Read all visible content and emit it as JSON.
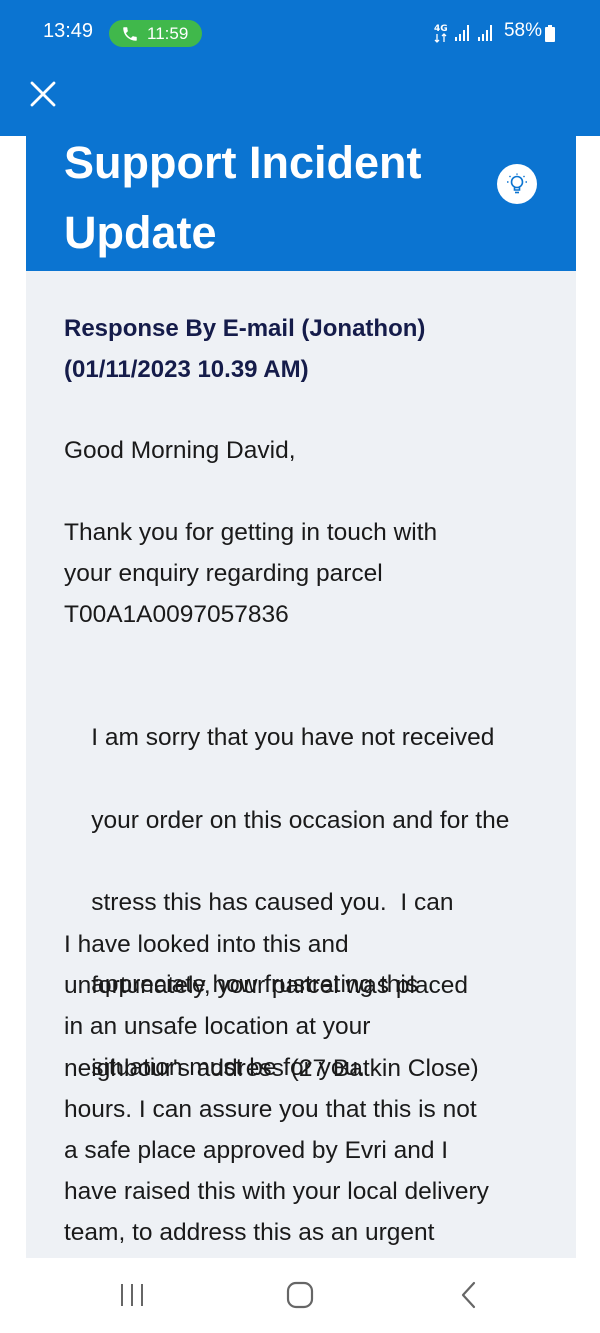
{
  "status_bar": {
    "time": "13:49",
    "call_duration": "11:59",
    "network": "4G",
    "battery": "58%"
  },
  "header": {
    "title": "Support Incident Update",
    "close_icon": "close-icon",
    "tip_icon": "lightbulb-icon"
  },
  "message": {
    "heading_line1": "Response By E-mail (Jonathon)",
    "heading_line2": "(01/11/2023 10.39 AM)",
    "greeting": "Good Morning David,",
    "para1": [
      "Thank you for getting in touch with",
      "your enquiry regarding parcel",
      "T00A1A0097057836"
    ],
    "para2": [
      "I am sorry that you have not received",
      "your order on this occasion and for the",
      "stress this has caused you.  I can",
      "appreciate how frustrating this",
      "situation must be for you."
    ],
    "para3": [
      "I have looked into this and",
      "unfortunately, your parcel was placed",
      "in an unsafe location at your",
      "neighbour's address (27 Batkin Close)",
      "hours. I can assure you that this is not",
      "a safe place approved by Evri and I",
      "have raised this with your local delivery",
      "team, to address this as an urgent"
    ]
  },
  "nav": {
    "recents_icon": "recents-icon",
    "home_icon": "home-icon",
    "back_icon": "back-icon"
  },
  "colors": {
    "brand_blue": "#0b74d1",
    "panel_bg": "#eef1f5",
    "heading_navy": "#151c4a",
    "call_green": "#40b84b"
  }
}
